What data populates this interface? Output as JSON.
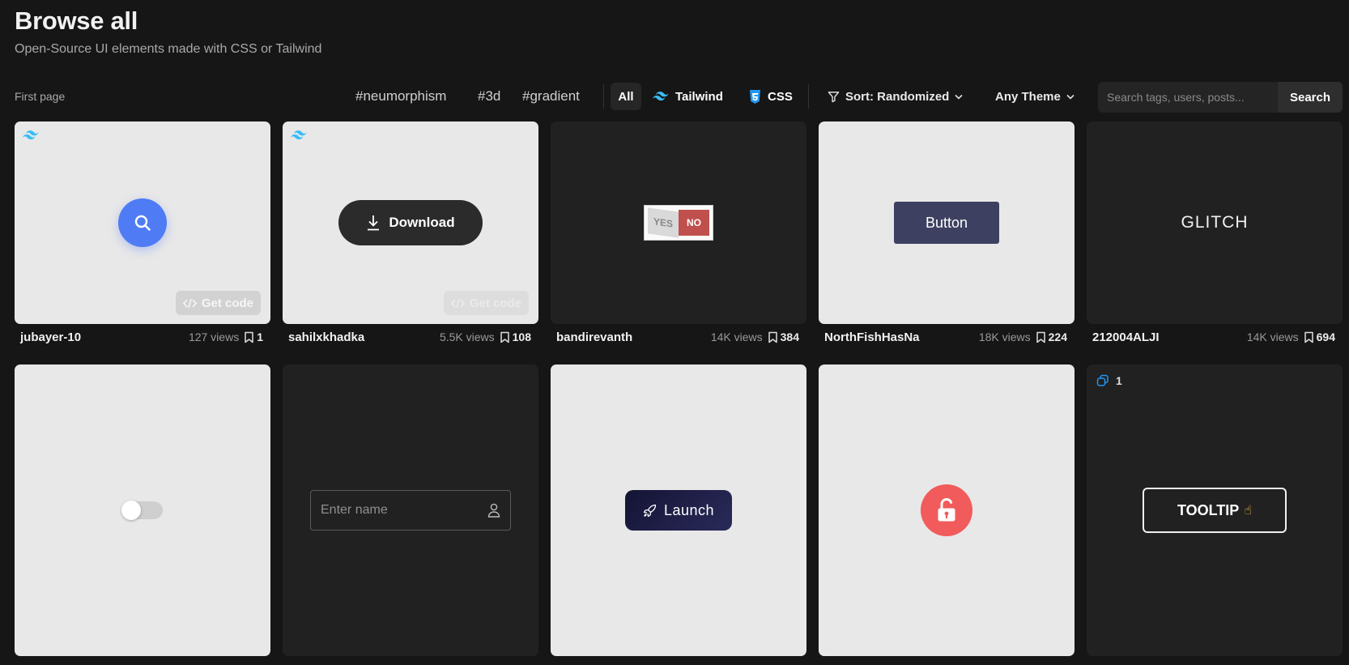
{
  "header": {
    "title": "Browse all",
    "subtitle": "Open-Source UI elements made with CSS or Tailwind",
    "first_page": "First page"
  },
  "tags": [
    "#neumorphism",
    "#3d",
    "#gradient"
  ],
  "filters": {
    "all": "All",
    "tailwind": "Tailwind",
    "css": "CSS"
  },
  "sort_label": "Sort: Randomized",
  "theme_label": "Any Theme",
  "search": {
    "placeholder": "Search tags, users, posts...",
    "button": "Search"
  },
  "accent_colors": {
    "tailwind": "#38bdf8",
    "css": "#2196f3",
    "search_button": "#4f7cf5",
    "unlock": "#f25b5b"
  },
  "cards": [
    {
      "user": "jubayer-10",
      "views": "127 views",
      "saves": "1",
      "get_code": "Get code"
    },
    {
      "user": "sahilxkhadka",
      "views": "5.5K views",
      "saves": "108",
      "get_code": "Get code",
      "button": "Download"
    },
    {
      "user": "bandirevanth",
      "views": "14K views",
      "saves": "384",
      "yes": "YES",
      "no": "NO"
    },
    {
      "user": "NorthFishHasNa",
      "views": "18K views",
      "saves": "224",
      "button": "Button"
    },
    {
      "user": "212004ALJI",
      "views": "14K views",
      "saves": "694",
      "text": "GLITCH"
    }
  ],
  "row2": {
    "input_placeholder": "Enter name",
    "launch": "Launch",
    "tooltip": "TOOLTIP",
    "copy_count": "1"
  }
}
